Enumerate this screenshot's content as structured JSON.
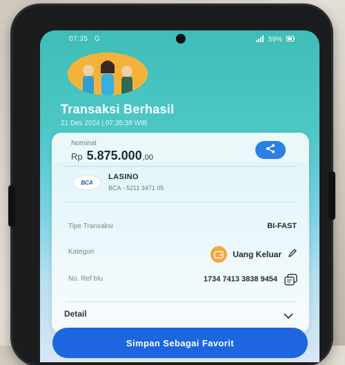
{
  "status_bar": {
    "time": "07:35",
    "indicators_left": "G",
    "battery": "59%"
  },
  "header": {
    "title": "Transaksi Berhasil",
    "datetime": "21 Des 2024 | 07:35:38 WIB"
  },
  "nominal": {
    "label": "Nominal",
    "currency": "Rp",
    "amount": "5.875.000",
    "decimals": ",00"
  },
  "recipient": {
    "bank_logo_text": "BCA",
    "name": "LASINO",
    "account": "BCA - 5211 3471 05"
  },
  "details": {
    "tipe_label": "Tipe Transaksi",
    "tipe_value": "BI-FAST",
    "kategori_label": "Kategori",
    "kategori_value": "Uang Keluar",
    "ref_label": "No. Ref blu",
    "ref_value": "1734 7413 3838 9454"
  },
  "detail_toggle": {
    "label": "Detail"
  },
  "actions": {
    "favorite_label": "Simpan Sebagai Favorit"
  },
  "icons": {
    "share": "share-icon",
    "category": "wallet-icon",
    "edit": "pencil-icon",
    "copy": "copy-icon",
    "chevron": "chevron-down-icon"
  },
  "colors": {
    "accent": "#1e66e0",
    "category_badge": "#f6a73a",
    "gradient_top": "#40bdb7"
  }
}
